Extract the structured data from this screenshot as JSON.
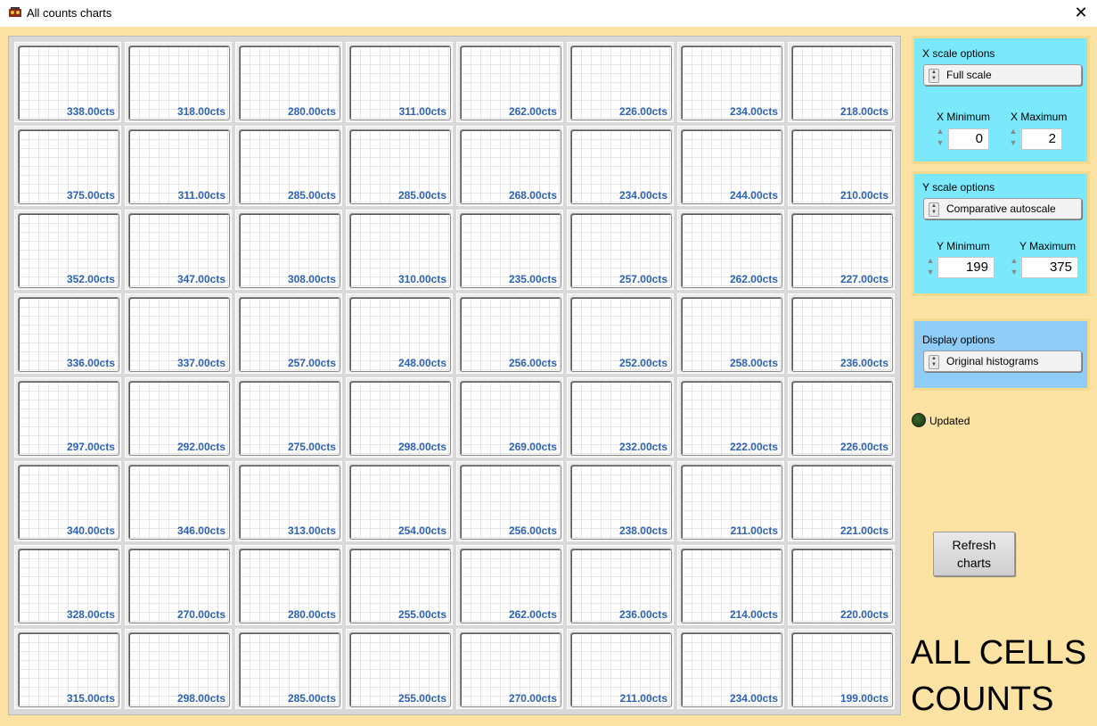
{
  "window": {
    "title": "All counts charts",
    "close_glyph": "✕"
  },
  "cells": [
    [
      "338.00cts",
      "318.00cts",
      "280.00cts",
      "311.00cts",
      "262.00cts",
      "226.00cts",
      "234.00cts",
      "218.00cts"
    ],
    [
      "375.00cts",
      "311.00cts",
      "285.00cts",
      "285.00cts",
      "268.00cts",
      "234.00cts",
      "244.00cts",
      "210.00cts"
    ],
    [
      "352.00cts",
      "347.00cts",
      "308.00cts",
      "310.00cts",
      "235.00cts",
      "257.00cts",
      "262.00cts",
      "227.00cts"
    ],
    [
      "336.00cts",
      "337.00cts",
      "257.00cts",
      "248.00cts",
      "256.00cts",
      "252.00cts",
      "258.00cts",
      "236.00cts"
    ],
    [
      "297.00cts",
      "292.00cts",
      "275.00cts",
      "298.00cts",
      "269.00cts",
      "232.00cts",
      "222.00cts",
      "226.00cts"
    ],
    [
      "340.00cts",
      "346.00cts",
      "313.00cts",
      "254.00cts",
      "256.00cts",
      "238.00cts",
      "211.00cts",
      "221.00cts"
    ],
    [
      "328.00cts",
      "270.00cts",
      "280.00cts",
      "255.00cts",
      "262.00cts",
      "236.00cts",
      "214.00cts",
      "220.00cts"
    ],
    [
      "315.00cts",
      "298.00cts",
      "285.00cts",
      "255.00cts",
      "270.00cts",
      "211.00cts",
      "234.00cts",
      "199.00cts"
    ]
  ],
  "x_scale": {
    "title": "X scale options",
    "mode": "Full scale",
    "min_label": "X Minimum",
    "max_label": "X Maximum",
    "min": "0",
    "max": "2"
  },
  "y_scale": {
    "title": "Y scale options",
    "mode": "Comparative autoscale",
    "min_label": "Y Minimum",
    "max_label": "Y Maximum",
    "min": "199",
    "max": "375"
  },
  "display": {
    "title": "Display options",
    "mode": "Original histograms"
  },
  "status": {
    "led_label": "Updated",
    "led_color": "#1f4a17"
  },
  "refresh_button": "Refresh\ncharts",
  "big_label": "ALL CELLS\nCOUNTS",
  "colors": {
    "panel_bg": "#fde3a3",
    "options_bg": "#7be9fb",
    "display_bg": "#8fcdf7",
    "count_text": "#2e63b6"
  }
}
